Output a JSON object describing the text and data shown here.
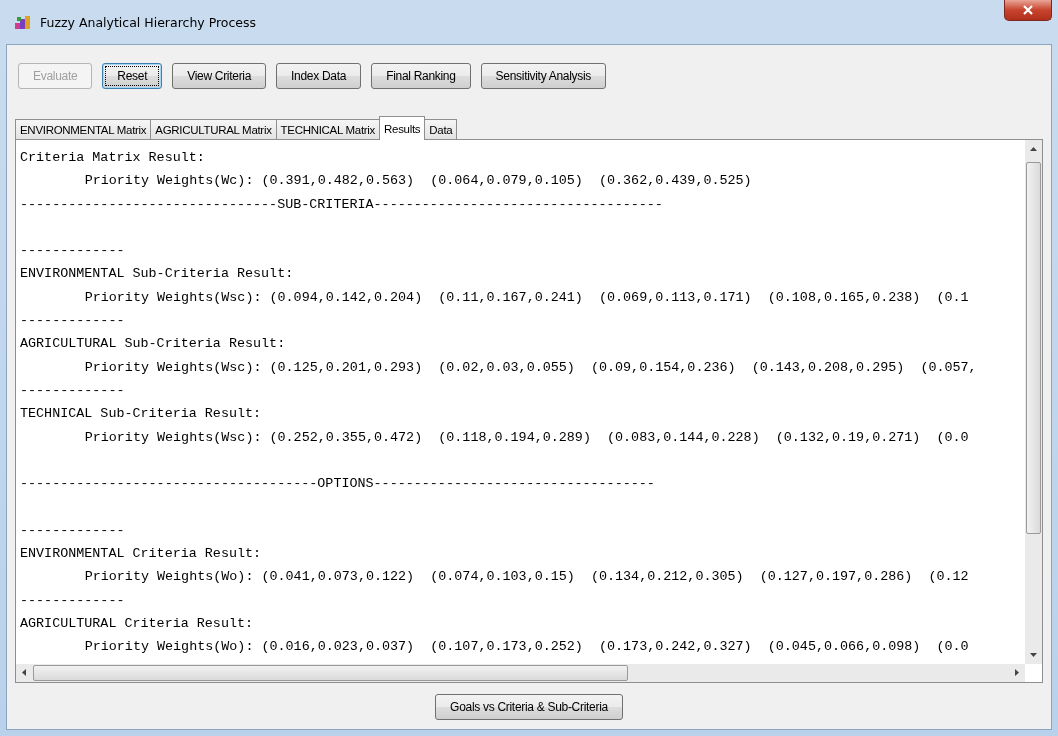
{
  "window": {
    "title": "Fuzzy Analytical Hierarchy Process"
  },
  "toolbar": [
    {
      "label": "Evaluate",
      "disabled": true,
      "focused": false
    },
    {
      "label": "Reset",
      "disabled": false,
      "focused": true
    },
    {
      "label": "View Criteria",
      "disabled": false,
      "focused": false
    },
    {
      "label": "Index Data",
      "disabled": false,
      "focused": false
    },
    {
      "label": "Final Ranking",
      "disabled": false,
      "focused": false
    },
    {
      "label": "Sensitivity Analysis",
      "disabled": false,
      "focused": false
    }
  ],
  "tabs": [
    {
      "label": "ENVIRONMENTAL Matrix",
      "selected": false
    },
    {
      "label": "AGRICULTURAL Matrix",
      "selected": false
    },
    {
      "label": "TECHNICAL Matrix",
      "selected": false
    },
    {
      "label": "Results",
      "selected": true
    },
    {
      "label": "Data",
      "selected": false
    }
  ],
  "results": {
    "lines": [
      {
        "kind": "heading",
        "text": "Criteria Matrix Result:"
      },
      {
        "kind": "weights",
        "text": "Priority Weights(Wc): (0.391,0.482,0.563)  (0.064,0.079,0.105)  (0.362,0.439,0.525)"
      },
      {
        "kind": "heading",
        "text": "--------------------------------SUB-CRITERIA------------------------------------"
      },
      {
        "kind": "blank"
      },
      {
        "kind": "heading",
        "text": "-------------"
      },
      {
        "kind": "heading",
        "text": "ENVIRONMENTAL Sub-Criteria Result:"
      },
      {
        "kind": "weights",
        "text": "Priority Weights(Wsc): (0.094,0.142,0.204)  (0.11,0.167,0.241)  (0.069,0.113,0.171)  (0.108,0.165,0.238)  (0.1"
      },
      {
        "kind": "heading",
        "text": "-------------"
      },
      {
        "kind": "heading",
        "text": "AGRICULTURAL Sub-Criteria Result:"
      },
      {
        "kind": "weights",
        "text": "Priority Weights(Wsc): (0.125,0.201,0.293)  (0.02,0.03,0.055)  (0.09,0.154,0.236)  (0.143,0.208,0.295)  (0.057,"
      },
      {
        "kind": "heading",
        "text": "-------------"
      },
      {
        "kind": "heading",
        "text": "TECHNICAL Sub-Criteria Result:"
      },
      {
        "kind": "weights",
        "text": "Priority Weights(Wsc): (0.252,0.355,0.472)  (0.118,0.194,0.289)  (0.083,0.144,0.228)  (0.132,0.19,0.271)  (0.0"
      },
      {
        "kind": "blank"
      },
      {
        "kind": "heading",
        "text": "-------------------------------------OPTIONS-----------------------------------"
      },
      {
        "kind": "blank"
      },
      {
        "kind": "heading",
        "text": "-------------"
      },
      {
        "kind": "heading",
        "text": "ENVIRONMENTAL Criteria Result:"
      },
      {
        "kind": "weights",
        "text": "Priority Weights(Wo): (0.041,0.073,0.122)  (0.074,0.103,0.15)  (0.134,0.212,0.305)  (0.127,0.197,0.286)  (0.12"
      },
      {
        "kind": "heading",
        "text": "-------------"
      },
      {
        "kind": "heading",
        "text": "AGRICULTURAL Criteria Result:"
      },
      {
        "kind": "weights",
        "text": "Priority Weights(Wo): (0.016,0.023,0.037)  (0.107,0.173,0.252)  (0.173,0.242,0.327)  (0.045,0.066,0.098)  (0.0"
      }
    ]
  },
  "footer_button": {
    "label": "Goals vs Criteria & Sub-Criteria"
  }
}
